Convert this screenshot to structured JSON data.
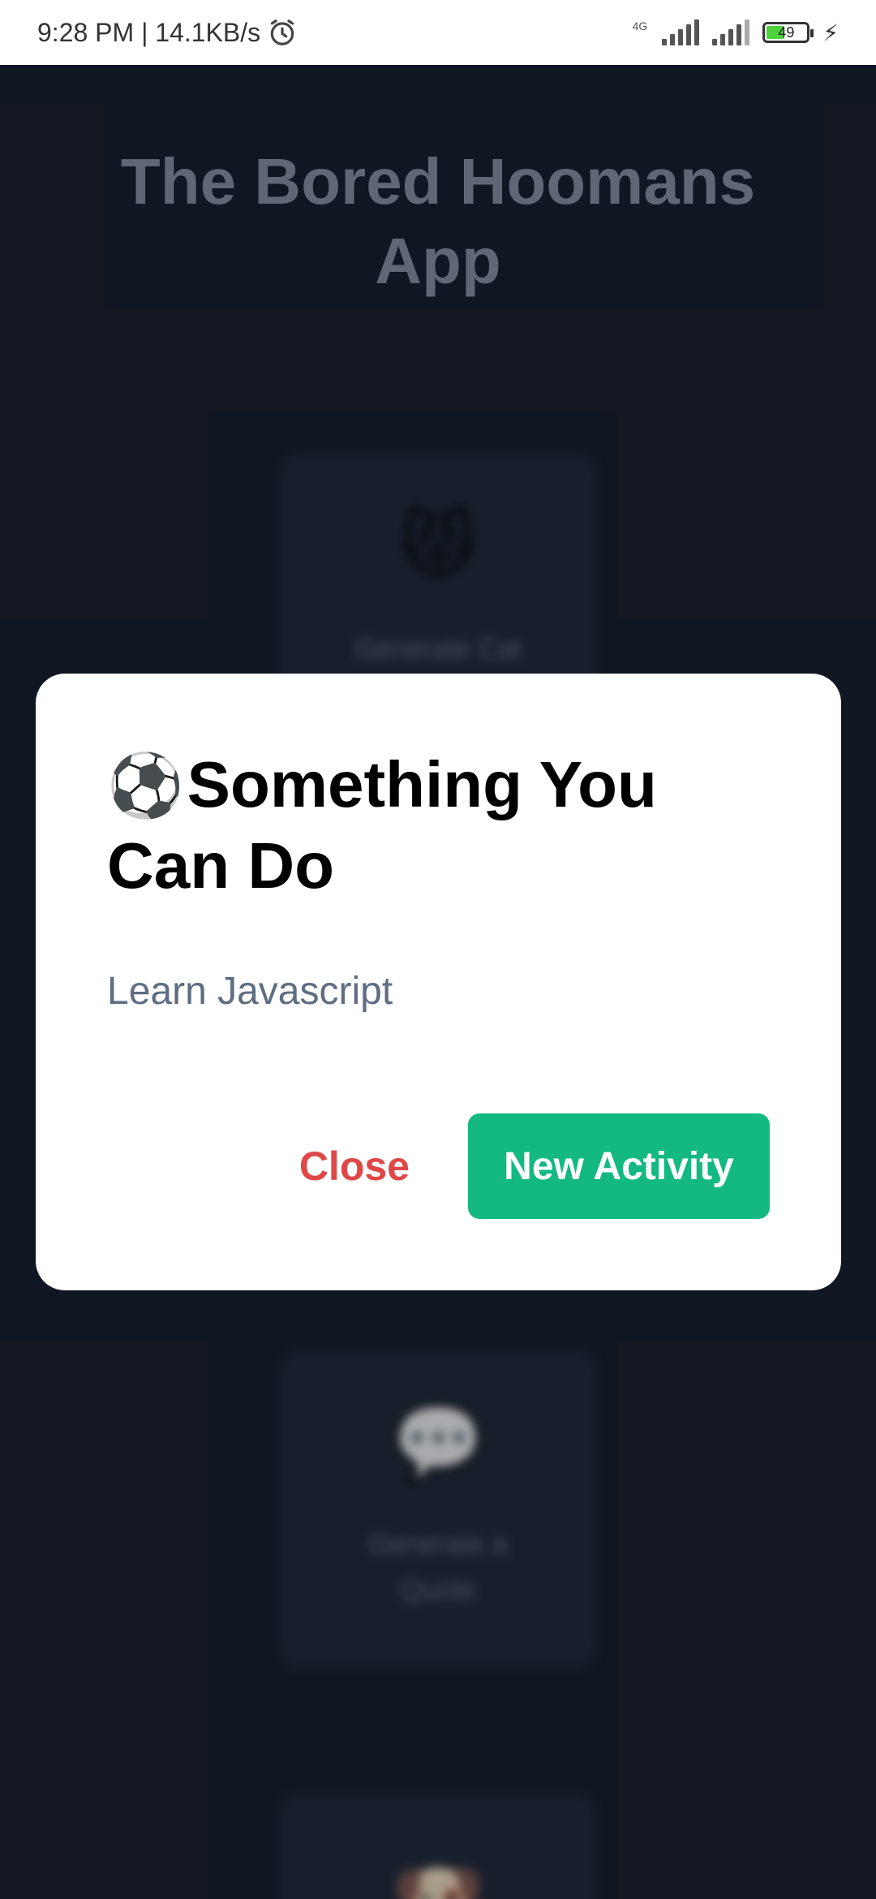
{
  "status_bar": {
    "time_speed": "9:28 PM | 14.1KB/s",
    "alarm_icon": "alarm-clock-icon",
    "network": "4G",
    "battery": "49",
    "charging_icon": "lightning-bolt-icon"
  },
  "app": {
    "title": "The Bored Hoomans\nApp"
  },
  "background_cards": [
    {
      "icon": "😾",
      "icon_name": "cat-face-icon",
      "label": "Generate Cat"
    },
    {
      "icon": "💬",
      "icon_name": "speech-bubble-icon",
      "label": "Generate a Quote"
    },
    {
      "icon": "🐶",
      "icon_name": "dog-face-icon",
      "label": ""
    }
  ],
  "modal": {
    "title_icon": "⚽",
    "title_icon_name": "soccer-ball-icon",
    "title": "Something You Can Do",
    "activity": "Learn Javascript",
    "close_label": "Close",
    "new_activity_label": "New Activity"
  },
  "colors": {
    "background": "#161c28",
    "card": "#212938",
    "accent_green": "#13b981",
    "close_red": "#e04848"
  }
}
